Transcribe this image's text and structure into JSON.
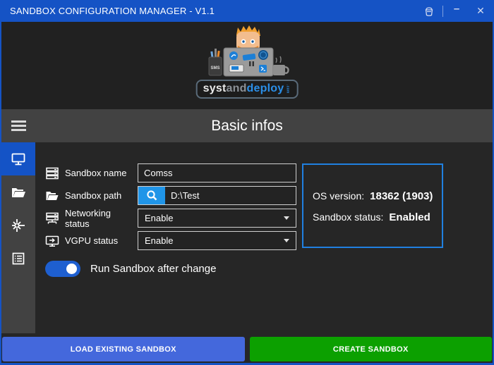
{
  "window": {
    "title": "SANDBOX CONFIGURATION MANAGER - V1.1",
    "controls": {
      "minimize": "–",
      "close": "✕"
    }
  },
  "logo": {
    "part1": "syst",
    "part2": "and",
    "part3": "deploy",
    "suffix": ".com"
  },
  "header": {
    "title": "Basic infos"
  },
  "sidebar": {
    "items": [
      {
        "id": "basic-infos",
        "icon": "monitor",
        "selected": true
      },
      {
        "id": "load-sandbox",
        "icon": "open-folder",
        "selected": false
      },
      {
        "id": "advanced",
        "icon": "starburst",
        "selected": false
      },
      {
        "id": "details",
        "icon": "list",
        "selected": false
      }
    ]
  },
  "form": {
    "sandbox_name": {
      "label": "Sandbox name",
      "value": "Comss"
    },
    "sandbox_path": {
      "label": "Sandbox path",
      "value": "D:\\Test"
    },
    "networking_status": {
      "label": "Networking status",
      "value": "Enable"
    },
    "vgpu_status": {
      "label": "VGPU status",
      "value": "Enable"
    },
    "run_after_change": {
      "label": "Run Sandbox after change",
      "enabled": true
    }
  },
  "info_panel": {
    "os_version_label": "OS version:",
    "os_version_value": "18362 (1903)",
    "sandbox_status_label": "Sandbox status:",
    "sandbox_status_value": "Enabled"
  },
  "footer": {
    "load_button": "LOAD EXISTING SANDBOX",
    "create_button": "CREATE SANDBOX"
  },
  "colors": {
    "accent_blue": "#1553c5",
    "search_blue": "#2095e8",
    "panel_border_blue": "#2080e0",
    "load_button_blue": "#4468dc",
    "create_button_green": "#0ca000",
    "toggle_blue": "#1e5fd0"
  }
}
